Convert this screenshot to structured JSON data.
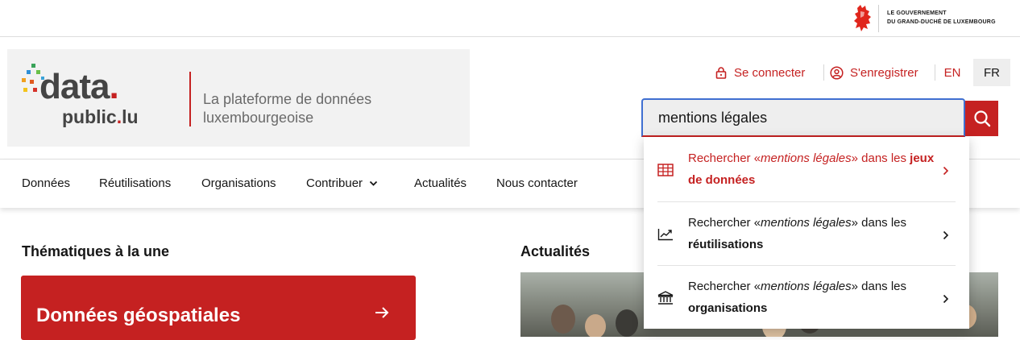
{
  "gov": {
    "line1": "LE GOUVERNEMENT",
    "line2": "DU GRAND-DUCHÉ DE LUXEMBOURG",
    "lion_icon": "red-lion-icon"
  },
  "logo": {
    "word": "data",
    "word_dot": ".",
    "sub": "public",
    "sub_dot": ".",
    "sub_tld": "lu",
    "tagline_line1": "La plateforme de données",
    "tagline_line2": "luxembourgeoise"
  },
  "header": {
    "login_label": "Se connecter",
    "register_label": "S'enregistrer",
    "lang_en": "EN",
    "lang_fr": "FR"
  },
  "search": {
    "value": "mentions légales",
    "button_icon": "search-icon"
  },
  "nav": {
    "items": [
      "Données",
      "Réutilisations",
      "Organisations",
      "Contribuer",
      "Actualités",
      "Nous contacter"
    ]
  },
  "main": {
    "themes_title": "Thématiques à la une",
    "theme_card_label": "Données géospatiales",
    "news_title": "Actualités"
  },
  "suggestions": [
    {
      "prefix": "Rechercher «",
      "query": "mentions légales",
      "middle": "» dans les ",
      "target_a": "jeux",
      "target_b": "de données",
      "icon": "table-icon"
    },
    {
      "prefix": "Rechercher «",
      "query": "mentions légales",
      "middle": "» dans les",
      "target": "réutilisations",
      "icon": "chart-icon"
    },
    {
      "prefix": "Rechercher «",
      "query": "mentions légales",
      "middle": "» dans les",
      "target": "organisations",
      "icon": "institution-icon"
    }
  ],
  "colors": {
    "brand_red": "#c52121",
    "focus_blue": "#3f6fd1"
  }
}
